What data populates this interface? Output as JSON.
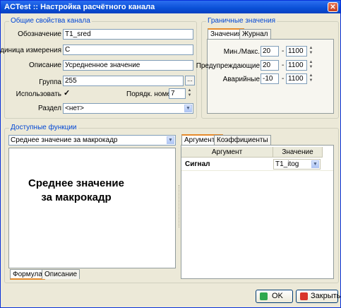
{
  "window": {
    "title": "ACTest :: Настройка расчётного канала",
    "close_glyph": "✕"
  },
  "general": {
    "legend": "Общие свойства канала",
    "designation_label": "Обозначение",
    "designation_value": "T1_sred",
    "unit_label": "Единица измерения",
    "unit_value": "С",
    "description_label": "Описание",
    "description_value": "Усредненное значение",
    "group_label": "Группа",
    "group_value": "255",
    "group_browse": "...",
    "use_label": "Использовать",
    "use_checked": "✓",
    "order_label": "Порядк. номер",
    "order_value": "7",
    "section_label": "Раздел",
    "section_value": "<нет>"
  },
  "limits": {
    "legend": "Граничные значения",
    "tabs": [
      "Значения",
      "Журнал"
    ],
    "rows": [
      {
        "label": "Мин./Макс.",
        "min": "20",
        "max": "1100"
      },
      {
        "label": "Предупреждающие",
        "min": "20",
        "max": "1100"
      },
      {
        "label": "Аварийные",
        "min": "-10",
        "max": "1100"
      }
    ],
    "dash": "-"
  },
  "functions": {
    "legend": "Доступные функции",
    "selected": "Среднее значение за макрокадр",
    "preview_text": "Среднее значение за макрокадр",
    "bottom_tabs": [
      "Формула",
      "Описание"
    ],
    "right_tabs": [
      "Аргументы",
      "Коэффициенты"
    ],
    "grid_headers": [
      "Аргумент",
      "Значение"
    ],
    "grid_rows": [
      {
        "argument": "Сигнал",
        "value": "T1_itog"
      }
    ]
  },
  "buttons": {
    "ok": "OK",
    "close": "Закрыть"
  },
  "colors": {
    "accent": "#0046d5",
    "title_bar": "#0a4fd6",
    "ok_icon": "#2fa84f",
    "close_icon": "#d9342b"
  }
}
